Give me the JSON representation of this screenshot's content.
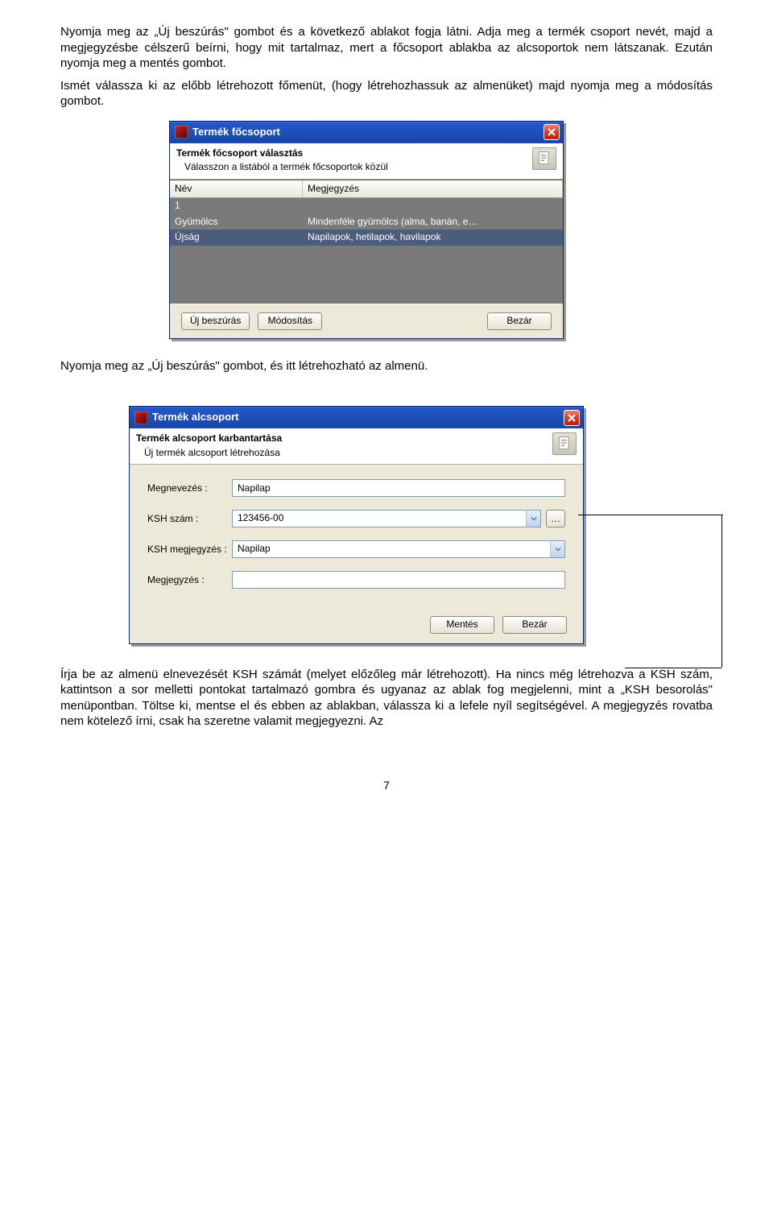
{
  "paragraphs": {
    "p1": "Nyomja meg az „Új beszúrás\" gombot és a következő ablakot fogja látni. Adja meg a termék csoport nevét, majd a megjegyzésbe célszerű beírni, hogy mit tartalmaz, mert a főcsoport ablakba az alcsoportok nem látszanak. Ezután nyomja meg a mentés gombot.",
    "p1b": "Ismét válassza ki az előbb létrehozott főmenüt, (hogy létrehozhassuk az almenüket) majd nyomja meg a módosítás gombot.",
    "p2": "Nyomja meg az „Új beszúrás\" gombot, és itt létrehozható az almenü.",
    "p3": "Írja be az almenü elnevezését KSH számát (melyet előzőleg már létrehozott). Ha nincs még létrehozva a KSH szám, kattintson a sor melletti pontokat tartalmazó gombra és ugyanaz az ablak fog megjelenni, mint a „KSH besorolás\" menüpontban. Töltse ki, mentse el és ebben az ablakban, válassza ki a lefele nyíl segítségével. A megjegyzés rovatba nem kötelező írni, csak ha szeretne valamit megjegyezni. Az"
  },
  "dialog1": {
    "title": "Termék főcsoport",
    "sub_title": "Termék főcsoport választás",
    "sub_desc": "Válasszon a listából a termék főcsoportok közül",
    "columns": {
      "name": "Név",
      "note": "Megjegyzés"
    },
    "rows": [
      {
        "name": "1",
        "note": ""
      },
      {
        "name": "Gyümölcs",
        "note": "Mindenféle gyümölcs (alma, banán, e…"
      },
      {
        "name": "Újság",
        "note": "Napilapok, hetilapok, havilapok"
      }
    ],
    "buttons": {
      "new": "Új beszúrás",
      "mod": "Módosítás",
      "close": "Bezár"
    }
  },
  "dialog2": {
    "title": "Termék alcsoport",
    "sub_title": "Termék alcsoport karbantartása",
    "sub_desc": "Új termék alcsoport létrehozása",
    "fields": {
      "name_label": "Megnevezés :",
      "name_value": "Napilap",
      "ksh_label": "KSH szám :",
      "ksh_value": "123456-00",
      "kshnote_label": "KSH megjegyzés :",
      "kshnote_value": "Napilap",
      "note_label": "Megjegyzés :",
      "note_value": ""
    },
    "dots": "…",
    "buttons": {
      "save": "Mentés",
      "close": "Bezár"
    }
  },
  "page_number": "7"
}
